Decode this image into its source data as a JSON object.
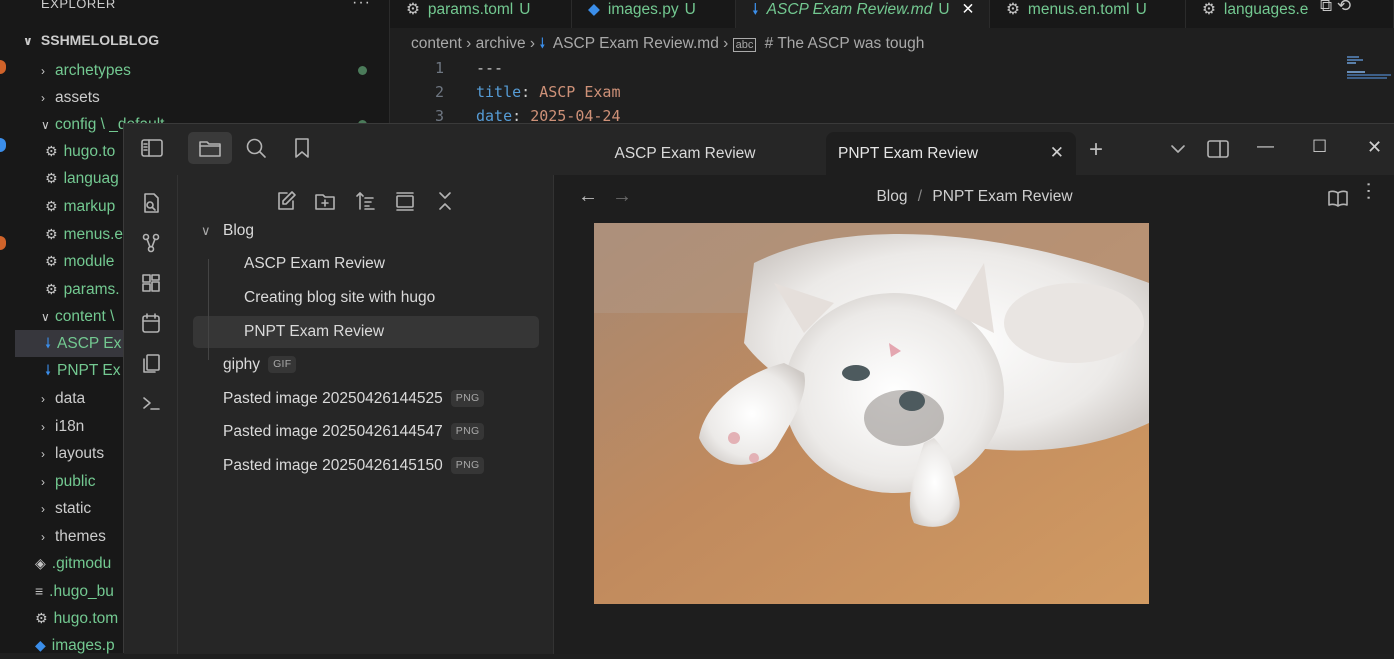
{
  "vscode": {
    "explorer": {
      "header": "EXPLORER",
      "more": "···",
      "root": "SSHMELOLBLOG",
      "items": [
        {
          "label": "archetypes",
          "kind": "folder",
          "expanded": false
        },
        {
          "label": "assets",
          "kind": "folder",
          "expanded": false
        },
        {
          "label": "config \\ _default",
          "kind": "folder",
          "expanded": true
        },
        {
          "label": "hugo.to",
          "kind": "toml"
        },
        {
          "label": "languag",
          "kind": "toml"
        },
        {
          "label": "markup",
          "kind": "toml"
        },
        {
          "label": "menus.e",
          "kind": "toml"
        },
        {
          "label": "module",
          "kind": "toml"
        },
        {
          "label": "params.",
          "kind": "toml"
        },
        {
          "label": "content \\",
          "kind": "folder",
          "expanded": true
        },
        {
          "label": "ASCP Ex",
          "kind": "md",
          "selected": true
        },
        {
          "label": "PNPT Ex",
          "kind": "md"
        },
        {
          "label": "data",
          "kind": "folder",
          "expanded": false
        },
        {
          "label": "i18n",
          "kind": "folder",
          "expanded": false
        },
        {
          "label": "layouts",
          "kind": "folder",
          "expanded": false
        },
        {
          "label": "public",
          "kind": "folder",
          "expanded": false
        },
        {
          "label": "static",
          "kind": "folder",
          "expanded": false
        },
        {
          "label": "themes",
          "kind": "folder",
          "expanded": false
        },
        {
          "label": ".gitmodu",
          "kind": "git"
        },
        {
          "label": ".hugo_bu",
          "kind": "lines"
        },
        {
          "label": "hugo.tom",
          "kind": "toml"
        },
        {
          "label": "images.p",
          "kind": "py"
        }
      ]
    },
    "tabs": [
      {
        "label": "params.toml",
        "status": "U",
        "icon": "gear-icon"
      },
      {
        "label": "images.py",
        "status": "U",
        "icon": "python-icon"
      },
      {
        "label": "ASCP Exam Review.md",
        "status": "U",
        "icon": "markdown-icon",
        "active": true,
        "close": "✕"
      },
      {
        "label": "menus.en.toml",
        "status": "U",
        "icon": "gear-icon"
      },
      {
        "label": "languages.e",
        "status": "",
        "icon": "gear-icon"
      }
    ],
    "breadcrumb": [
      "content",
      "archive",
      "ASCP Exam Review.md",
      "# The ASCP was tough"
    ],
    "code": [
      {
        "n": "1",
        "key": "---",
        "val": ""
      },
      {
        "n": "2",
        "key": "title",
        "val": "ASCP Exam"
      },
      {
        "n": "3",
        "key": "date",
        "val": "2025-04-24"
      }
    ]
  },
  "obsidian": {
    "tabs": [
      {
        "label": "ASCP Exam Review",
        "active": false
      },
      {
        "label": "PNPT Exam Review",
        "active": true,
        "close": "✕"
      }
    ],
    "new_tab": "+",
    "window": {
      "minimize": "—",
      "maximize": "☐",
      "close": "✕"
    },
    "tree": [
      {
        "label": "Blog",
        "kind": "folder",
        "expanded": true
      },
      {
        "label": "ASCP Exam Review",
        "kind": "note",
        "child": true
      },
      {
        "label": "Creating blog site with hugo",
        "kind": "note",
        "child": true
      },
      {
        "label": "PNPT Exam Review",
        "kind": "note",
        "child": true,
        "selected": true
      },
      {
        "label": "giphy",
        "kind": "file",
        "badge": "GIF"
      },
      {
        "label": "Pasted image 20250426144525",
        "kind": "file",
        "badge": "PNG"
      },
      {
        "label": "Pasted image 20250426144547",
        "kind": "file",
        "badge": "PNG"
      },
      {
        "label": "Pasted image 20250426145150",
        "kind": "file",
        "badge": "PNG"
      }
    ],
    "breadcrumb": {
      "parent": "Blog",
      "sep": "/",
      "current": "PNPT Exam Review"
    },
    "nav": {
      "back": "←",
      "forward": "→"
    }
  }
}
